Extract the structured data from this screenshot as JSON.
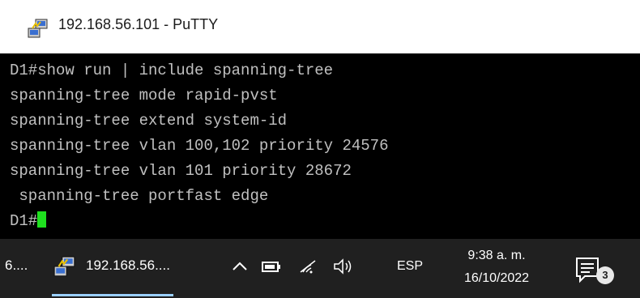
{
  "window": {
    "title": "192.168.56.101 - PuTTY",
    "icon": "putty-icon"
  },
  "terminal": {
    "lines": [
      "D1#show run | include spanning-tree",
      "spanning-tree mode rapid-pvst",
      "spanning-tree extend system-id",
      "spanning-tree vlan 100,102 priority 24576",
      "spanning-tree vlan 101 priority 28672",
      " spanning-tree portfast edge"
    ],
    "prompt": "D1#",
    "cursor_color": "#1fe01f"
  },
  "taskbar": {
    "left_item_label": "6....",
    "putty_item_label": "192.168.56....",
    "tray": {
      "icons": [
        "chevron-up-icon",
        "battery-icon",
        "wifi-icon",
        "speaker-icon"
      ],
      "language": "ESP",
      "time": "9:38 a. m.",
      "date": "16/10/2022"
    },
    "notification_count": "3"
  }
}
